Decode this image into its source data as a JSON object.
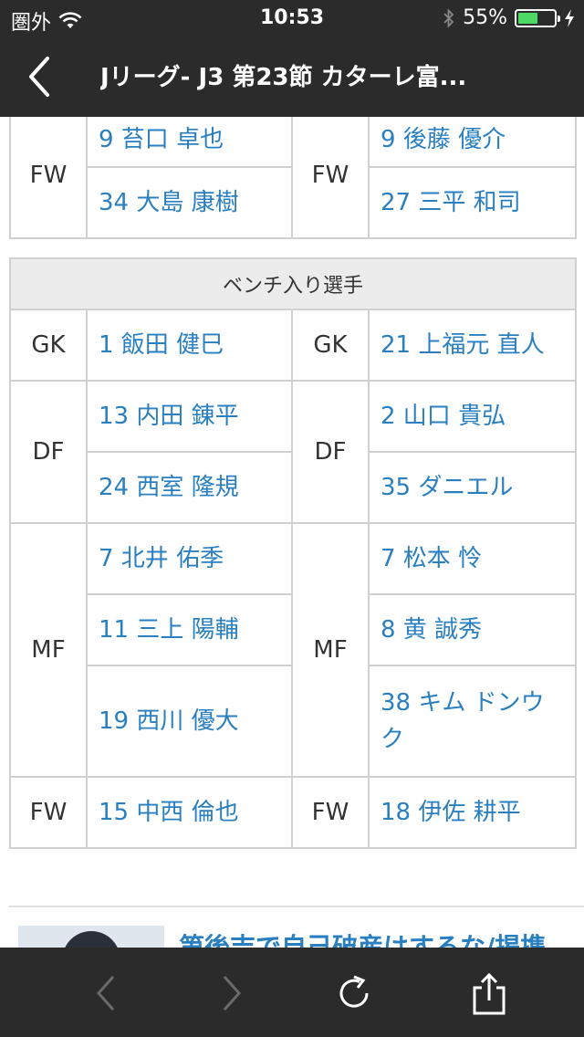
{
  "status": {
    "carrier": "圏外",
    "time": "10:53",
    "battery_percent": "55%",
    "battery_level": 0.55,
    "battery_color": "#4cd964"
  },
  "nav": {
    "title": "Jリーグ- J3 第23節 カターレ富..."
  },
  "lineup_tail": {
    "rows": [
      {
        "pos": "FW",
        "home": [
          "9 苔口 卓也",
          "34 大島 康樹"
        ],
        "away": [
          "9 後藤 優介",
          "27 三平 和司"
        ]
      }
    ]
  },
  "bench": {
    "header": "ベンチ入り選手",
    "rows": [
      {
        "pos": "GK",
        "home": [
          "1 飯田 健巳"
        ],
        "away": [
          "21 上福元 直人"
        ]
      },
      {
        "pos": "DF",
        "home": [
          "13 内田 錬平",
          "24 西室 隆規"
        ],
        "away": [
          "2 山口 貴弘",
          "35 ダニエル"
        ]
      },
      {
        "pos": "MF",
        "home": [
          "7 北井 佑季",
          "11 三上 陽輔",
          "19 西川 優大"
        ],
        "away": [
          "7 松本 怜",
          "8 黄 誠秀",
          "38 キム ドンウク"
        ]
      },
      {
        "pos": "FW",
        "home": [
          "15 中西 倫也"
        ],
        "away": [
          "18 伊佐 耕平"
        ]
      }
    ]
  },
  "article": {
    "title": "第後吉で自己破産はするな/掲携"
  },
  "colors": {
    "bar": "#2b2b2b",
    "link": "#2a7fc0",
    "grid": "#d0d0d0"
  }
}
